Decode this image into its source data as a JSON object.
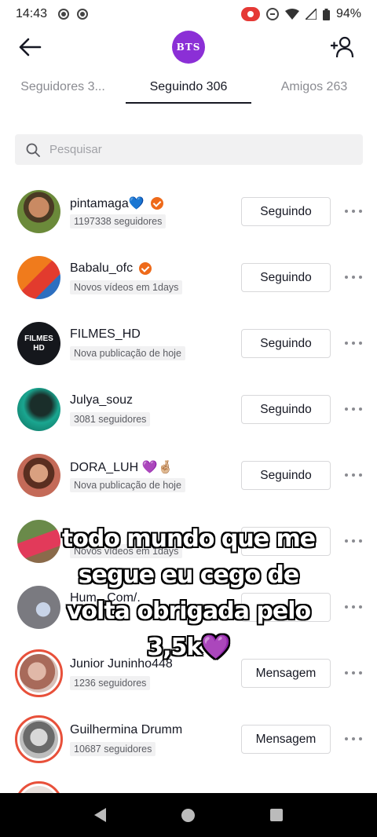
{
  "status_bar": {
    "time": "14:43",
    "battery": "94%"
  },
  "header": {
    "avatar_label": "BTS"
  },
  "tabs": [
    {
      "label": "Seguidores 3..."
    },
    {
      "label": "Seguindo 306"
    },
    {
      "label": "Amigos 263"
    }
  ],
  "search": {
    "placeholder": "Pesquisar"
  },
  "users": [
    {
      "name": "pintamaga💙",
      "subtitle": "1197338 seguidores",
      "button": "Seguindo",
      "verified": true
    },
    {
      "name": "Babalu_ofc",
      "subtitle": "Novos vídeos em 1days",
      "button": "Seguindo",
      "verified": true
    },
    {
      "name": "FILMES_HD",
      "subtitle": "Nova publicação de hoje",
      "button": "Seguindo",
      "verified": false,
      "avatar_text": "FILMES HD"
    },
    {
      "name": "Julya_souz",
      "subtitle": "3081 seguidores",
      "button": "Seguindo",
      "verified": false
    },
    {
      "name": "DORA_LUH 💜🤞🏼",
      "subtitle": "Nova publicação de hoje",
      "button": "Seguindo",
      "verified": false
    },
    {
      "name": "",
      "subtitle": "Novos vídeos em 1days",
      "button": "",
      "verified": false
    },
    {
      "name": "Hum...Com/.",
      "subtitle": "",
      "button": "",
      "verified": false
    },
    {
      "name": "Junior Juninho448",
      "subtitle": "1236 seguidores",
      "button": "Mensagem",
      "verified": false
    },
    {
      "name": "Guilhermina Drumm",
      "subtitle": "10687 seguidores",
      "button": "Mensagem",
      "verified": false
    }
  ],
  "overlay": {
    "line1": "todo mundo que me",
    "line2": "segue eu cego de",
    "line3": "volta obrigada pelo",
    "line4": "3,5k💜"
  },
  "colors": {
    "accent": "#ee6a1a",
    "ring": "#e8503a",
    "bts_purple": "#8b2fd6"
  }
}
